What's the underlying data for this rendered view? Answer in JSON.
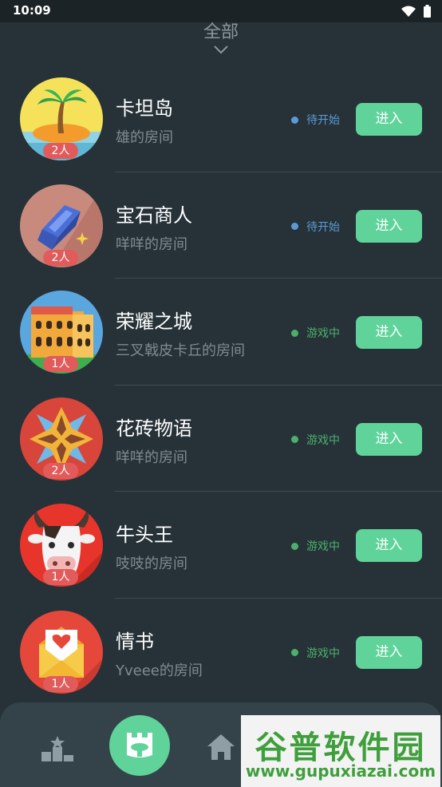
{
  "status_bar": {
    "time": "10:09"
  },
  "filter": {
    "label": "全部"
  },
  "colors": {
    "background": "#263238",
    "accent_green": "#5fd39a",
    "pending_blue": "#5b9bd5",
    "playing_green": "#4caf6a",
    "badge_red": "#e25b5b"
  },
  "rooms": [
    {
      "name": "卡坦岛",
      "owner": "雄的房间",
      "players": "2人",
      "status": "待开始",
      "status_kind": "pending",
      "enter": "进入",
      "icon": "island-icon"
    },
    {
      "name": "宝石商人",
      "owner": "咩咩的房间",
      "players": "2人",
      "status": "待开始",
      "status_kind": "pending",
      "enter": "进入",
      "icon": "gem-icon"
    },
    {
      "name": "荣耀之城",
      "owner": "三叉戟皮卡丘的房间",
      "players": "1人",
      "status": "游戏中",
      "status_kind": "playing",
      "enter": "进入",
      "icon": "colosseum-icon"
    },
    {
      "name": "花砖物语",
      "owner": "咩咩的房间",
      "players": "2人",
      "status": "游戏中",
      "status_kind": "playing",
      "enter": "进入",
      "icon": "tile-flower-icon"
    },
    {
      "name": "牛头王",
      "owner": "吱吱的房间",
      "players": "1人",
      "status": "游戏中",
      "status_kind": "playing",
      "enter": "进入",
      "icon": "bull-icon"
    },
    {
      "name": "情书",
      "owner": "Yveee的房间",
      "players": "1人",
      "status": "游戏中",
      "status_kind": "playing",
      "enter": "进入",
      "icon": "love-letter-icon"
    }
  ],
  "bottom_nav": {
    "items": [
      "ranking-icon",
      "arena-icon",
      "home-icon"
    ]
  },
  "watermark": {
    "title": "谷普软件园",
    "url": "www.gupuxiazai.com"
  }
}
